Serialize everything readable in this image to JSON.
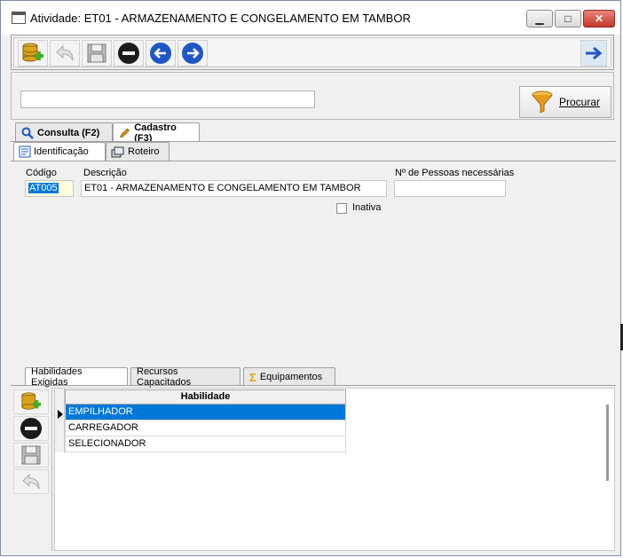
{
  "window": {
    "title": "Atividade: ET01 - ARMAZENAMENTO E CONGELAMENTO EM TAMBOR",
    "min_label": "▁",
    "max_label": "□",
    "close_label": "✕"
  },
  "toolbar": {
    "icons": [
      "database-add-icon",
      "undo-icon",
      "save-icon",
      "remove-icon",
      "prev-icon",
      "next-icon",
      "forward-icon"
    ]
  },
  "search": {
    "value": "",
    "button_label": "Procurar"
  },
  "tabs": {
    "consulta": "Consulta (F2)",
    "cadastro": "Cadastro (F3)"
  },
  "subtabs": {
    "identificacao": "Identificação",
    "roteiro": "Roteiro"
  },
  "form": {
    "codigo_label": "Código",
    "codigo_value": "AT005",
    "descricao_label": "Descrição",
    "descricao_value": "ET01 - ARMAZENAMENTO E CONGELAMENTO EM TAMBOR",
    "pessoas_label": "Nº de Pessoas necessárias",
    "pessoas_value": "",
    "inativa_label": "Inativa",
    "inativa_checked": false
  },
  "bottom_tabs": {
    "habilidades": "Habilidades Exigidas",
    "recursos": "Recursos Capacitados",
    "equipamentos": "Equipamentos"
  },
  "grid": {
    "header": "Habilidade",
    "rows": [
      "EMPILHADOR",
      "CARREGADOR",
      "SELECIONADOR"
    ],
    "selected_row": 0
  },
  "colors": {
    "selection": "#0078d7",
    "blue_nav": "#1f56c2",
    "db_gold": "#d9a21a",
    "add_green": "#3fae2a"
  }
}
